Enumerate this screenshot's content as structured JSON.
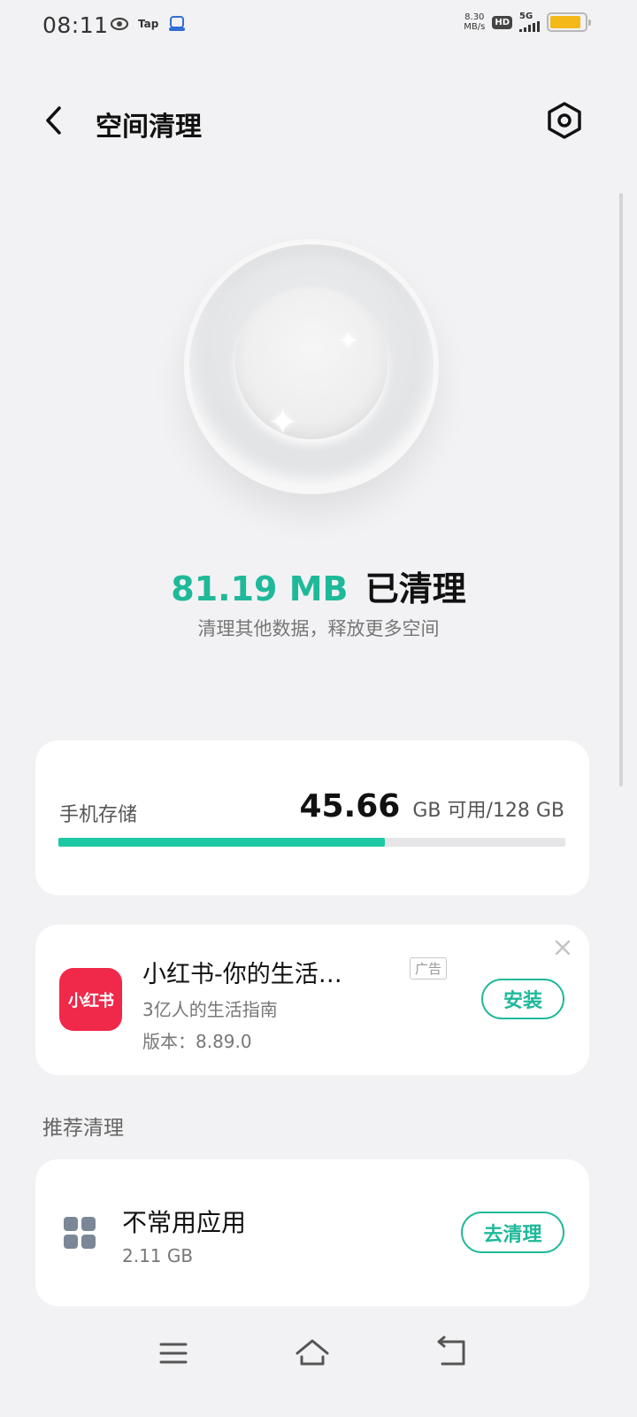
{
  "status_bar": {
    "time": "08:11",
    "left_icons": [
      "app-notification-icon",
      "Tap",
      "app-notification-icon"
    ],
    "tap_label": "Tap",
    "net_speed_value": "8.30",
    "net_speed_unit": "MB/s",
    "hd_label": "HD",
    "network_label": "5G",
    "battery_level": 0.9,
    "battery_color": "#f5b819"
  },
  "header": {
    "title": "空间清理",
    "back_icon": "chevron-left-icon",
    "settings_icon": "settings-hexagon-icon"
  },
  "cleaned": {
    "amount": "81.19 MB",
    "label": "已清理",
    "subtitle": "清理其他数据，释放更多空间",
    "accent_color": "#1fb99a"
  },
  "storage": {
    "label": "手机存储",
    "free_value": "45.66",
    "unit_text": "GB 可用/128 GB",
    "used_fraction": 0.6433,
    "bar_color": "#1cc9a4"
  },
  "ad": {
    "app_icon_text": "小红书",
    "title": "小红书-你的生活…",
    "badge": "广告",
    "description": "3亿人的生活指南",
    "version": "版本：8.89.0",
    "install_label": "安装",
    "icon_color": "#f0284a"
  },
  "recommend": {
    "section_title": "推荐清理",
    "items": [
      {
        "title": "不常用应用",
        "size": "2.11 GB",
        "action_label": "去清理",
        "icon": "apps-grid-icon"
      }
    ]
  },
  "nav_bar": {
    "icons": [
      "menu-icon",
      "home-icon",
      "back-icon"
    ]
  }
}
